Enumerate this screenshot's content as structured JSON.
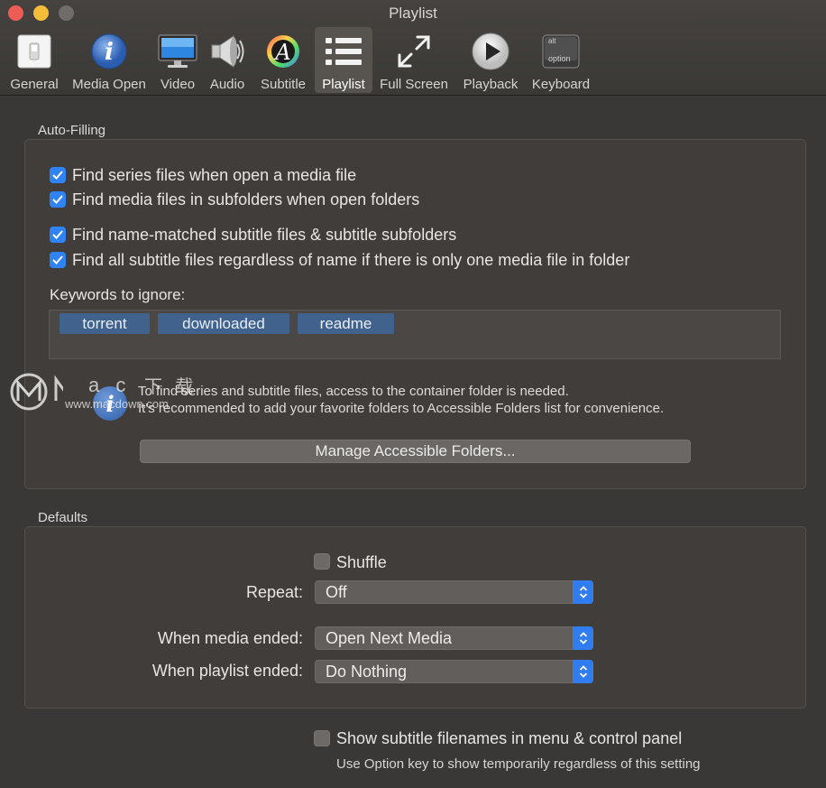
{
  "window": {
    "title": "Playlist"
  },
  "toolbar": {
    "tabs": [
      {
        "label": "General",
        "icon": "switch-icon"
      },
      {
        "label": "Media Open",
        "icon": "info-icon"
      },
      {
        "label": "Video",
        "icon": "monitor-icon"
      },
      {
        "label": "Audio",
        "icon": "speaker-icon"
      },
      {
        "label": "Subtitle",
        "icon": "font-icon"
      },
      {
        "label": "Playlist",
        "icon": "list-icon",
        "active": true
      },
      {
        "label": "Full Screen",
        "icon": "expand-icon"
      },
      {
        "label": "Playback",
        "icon": "play-icon"
      },
      {
        "label": "Keyboard",
        "icon": "option-key-icon"
      }
    ],
    "keycap_top": "alt",
    "keycap_bottom": "option"
  },
  "auto_filling": {
    "title": "Auto-Filling",
    "checkboxes": [
      {
        "label": "Find series files when open a media file",
        "checked": true
      },
      {
        "label": "Find media files in subfolders when open folders",
        "checked": true
      },
      {
        "label": "Find name-matched subtitle files & subtitle subfolders",
        "checked": true
      },
      {
        "label": "Find all subtitle files regardless of name if there is only one media file in folder",
        "checked": true
      }
    ],
    "keywords_label": "Keywords to ignore:",
    "keywords": [
      "torrent",
      "downloaded",
      "readme"
    ],
    "info_line1": "To find series and subtitle files, access to the container folder is needed.",
    "info_line2": "It's recommended to add your favorite folders to Accessible Folders list for convenience.",
    "manage_button": "Manage Accessible Folders..."
  },
  "defaults": {
    "title": "Defaults",
    "shuffle_label": "Shuffle",
    "shuffle_checked": false,
    "repeat_label": "Repeat:",
    "repeat_value": "Off",
    "media_ended_label": "When media ended:",
    "media_ended_value": "Open Next Media",
    "playlist_ended_label": "When playlist ended:",
    "playlist_ended_value": "Do Nothing"
  },
  "bottom": {
    "show_filenames_label": "Show subtitle filenames in menu & control panel",
    "show_filenames_checked": false,
    "hint": "Use Option key to show temporarily regardless of this setting"
  },
  "watermark": {
    "brand_letters": "a c",
    "cjk": "下 载",
    "url": "www.macdown.com"
  },
  "colors": {
    "accent": "#2f83f4",
    "token": "#40628d",
    "background": "#3a3836"
  }
}
